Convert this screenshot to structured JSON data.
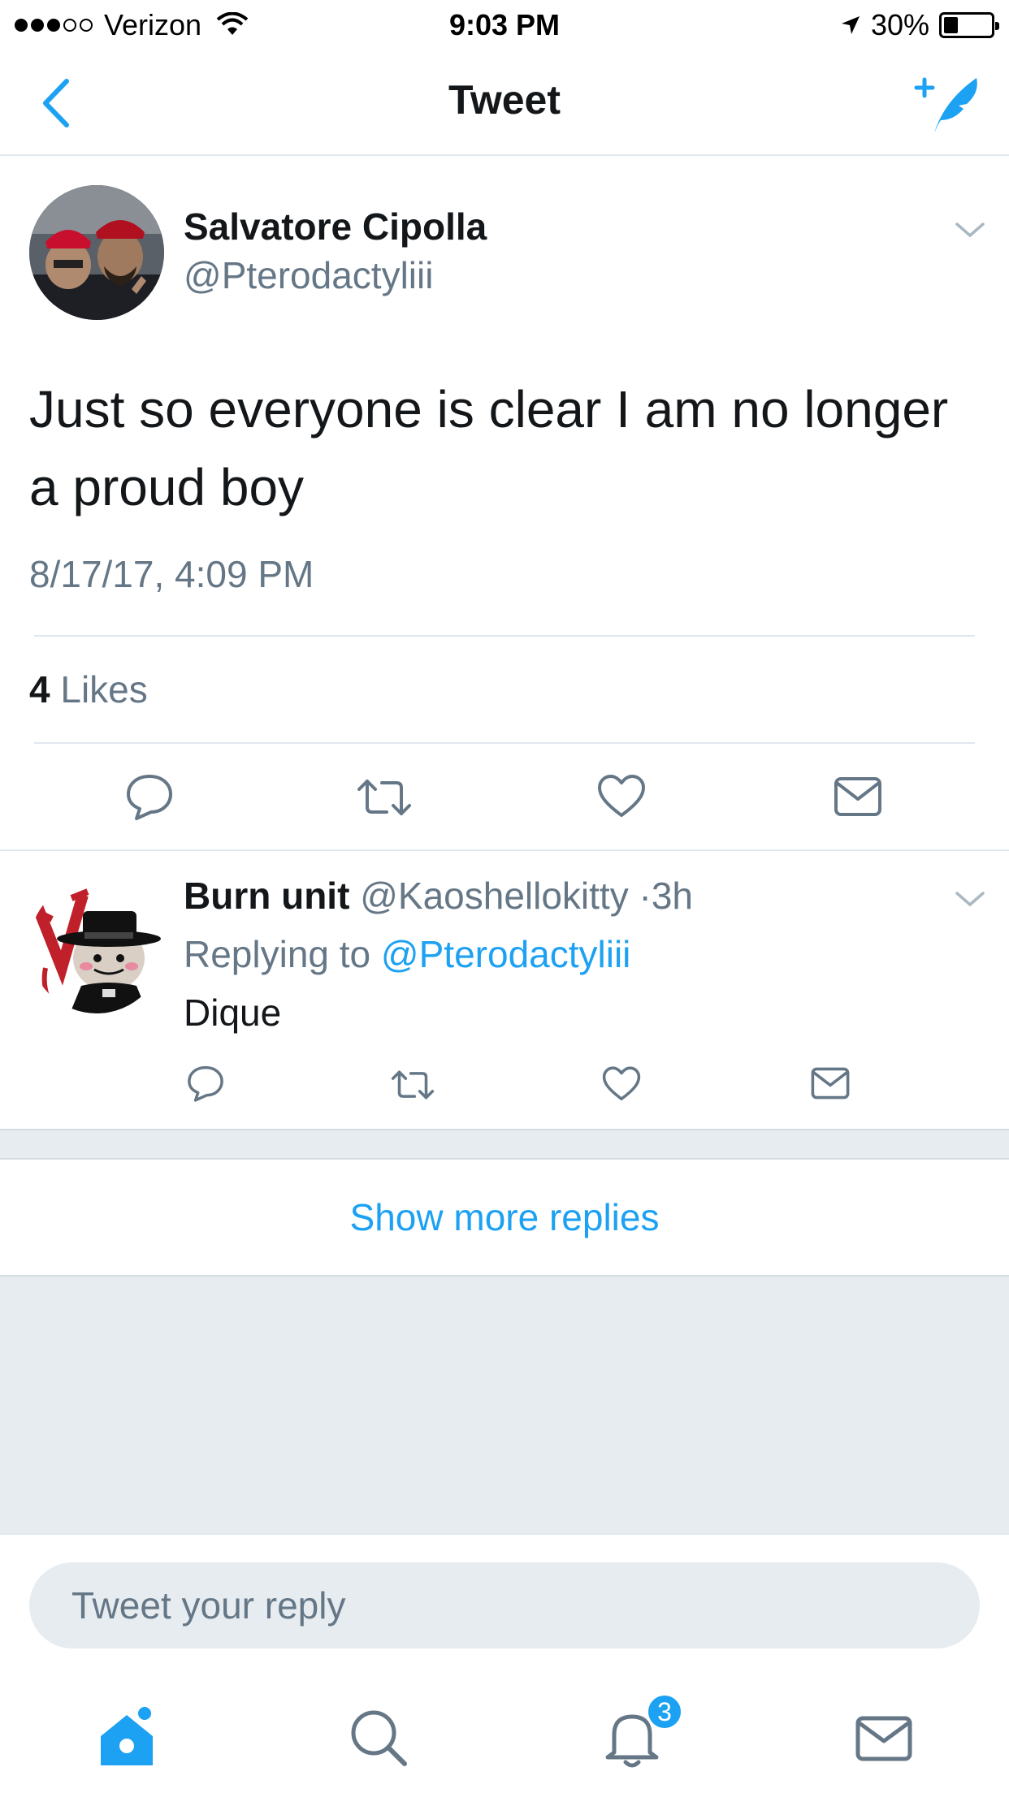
{
  "status_bar": {
    "carrier": "Verizon",
    "time": "9:03 PM",
    "battery": "30%",
    "battery_level": 0.3
  },
  "nav": {
    "title": "Tweet",
    "back_icon": "chevron-left-icon",
    "compose_icon": "compose-feather-icon"
  },
  "tweet": {
    "author_name": "Salvatore Cipolla",
    "author_handle": "@Pterodactyliii",
    "text": "Just so everyone is clear I am no longer a proud boy",
    "timestamp": "8/17/17, 4:09 PM",
    "likes_count": "4",
    "likes_label": "Likes",
    "actions": [
      "reply-icon",
      "retweet-icon",
      "like-icon",
      "direct-message-icon"
    ]
  },
  "reply": {
    "author_name": "Burn unit",
    "author_handle": "@Kaoshellokitty",
    "age": "3h",
    "replying_label": "Replying to",
    "replying_to": "@Pterodactyliii",
    "text": "Dique"
  },
  "show_more": "Show more replies",
  "composer": {
    "placeholder": "Tweet your reply"
  },
  "tab_bar": {
    "tabs": [
      "home-icon",
      "search-icon",
      "notifications-icon",
      "messages-icon"
    ],
    "notifications_badge": "3"
  },
  "colors": {
    "accent": "#1da1f2",
    "secondary_text": "#657786",
    "divider": "#e1e8ed",
    "background_gray": "#e6ecf0"
  }
}
